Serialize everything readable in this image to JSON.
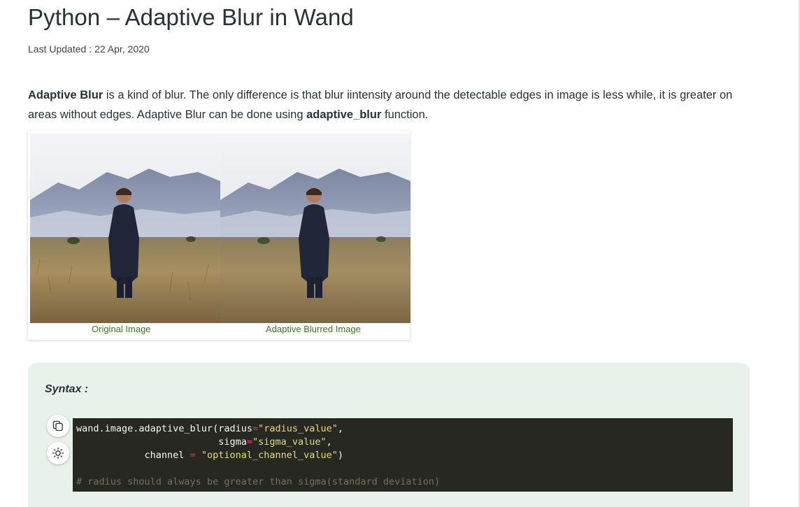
{
  "article": {
    "title": "Python – Adaptive Blur in Wand",
    "updated_label": "Last Updated :",
    "updated_date": "22 Apr, 2020"
  },
  "intro": {
    "term": "Adaptive Blur",
    "text1": " is a kind of blur. The only difference is that blur iintensity around the detectable edges in image is less while, it is greater on areas without edges. Adaptive Blur can be done using ",
    "func": "adaptive_blur",
    "text2": " function."
  },
  "figure": {
    "caption_left": "Original Image",
    "caption_right": "Adaptive Blurred Image"
  },
  "syntax": {
    "label": "Syntax :",
    "copy_icon": "copy-icon",
    "theme_icon": "sun-icon",
    "code": {
      "l1_a": "wand.image.adaptive_blur(radius",
      "l1_op": "=",
      "l1_str": "\"radius_value\"",
      "l1_end": ",",
      "l2_a": "                         sigma",
      "l2_op": "=",
      "l2_str": "\"sigma_value\"",
      "l2_end": ",",
      "l3_a": "            channel ",
      "l3_op": "=",
      "l3_str": " \"optional_channel_value\"",
      "l3_end": ")",
      "comment": "# radius should always be greater than sigma(standard deviation)"
    }
  },
  "colors": {
    "syntax_bg": "#e8f1ea",
    "code_bg": "#272822",
    "caption": "#3c7a2a"
  }
}
